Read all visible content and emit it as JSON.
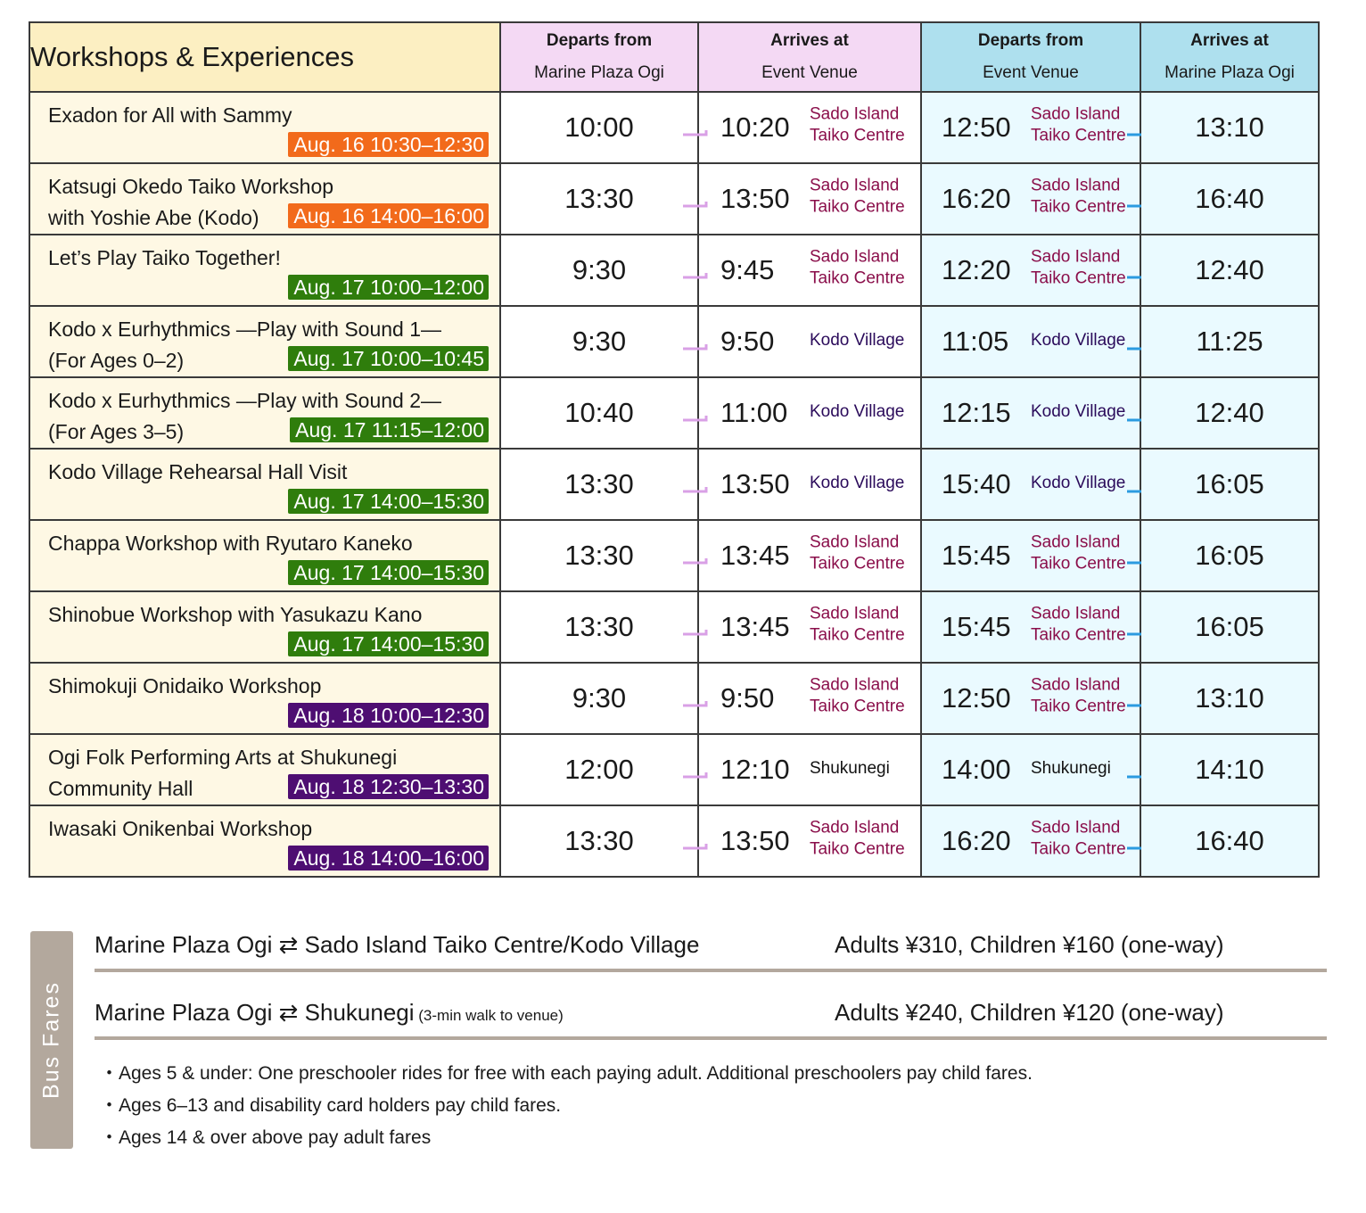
{
  "header": {
    "title": "Workshops & Experiences",
    "columns": [
      {
        "line1": "Departs from",
        "line2": "Marine Plaza Ogi"
      },
      {
        "line1": "Arrives at",
        "line2": "Event Venue"
      },
      {
        "line1": "Departs from",
        "line2": "Event Venue"
      },
      {
        "line1": "Arrives at",
        "line2": "Marine Plaza Ogi"
      }
    ]
  },
  "colors": {
    "aug16": "#f26a1b",
    "aug17": "#2f7d0c",
    "aug18": "#4e0e72",
    "outbound_arrow": "#d9a0e6",
    "return_arrow": "#2b9be0",
    "header_title_bg": "#fcefc2",
    "header_outbound_bg": "#f4d9f4",
    "header_return_bg": "#aee0ee",
    "fare_bar": "#b3a89d"
  },
  "rows": [
    {
      "name": "Exadon for All with Sammy",
      "badge": "Aug. 16  10:30–12:30",
      "day": "aug16",
      "dep": "10:00",
      "arr": "10:20",
      "venue1": "Sado Island",
      "venue2": "Taiko Centre",
      "vtype": "taiko",
      "ret_dep": "12:50",
      "ret_arr": "13:10"
    },
    {
      "name": "Katsugi Okedo Taiko Workshop\nwith Yoshie Abe (Kodo)",
      "badge": "Aug. 16  14:00–16:00",
      "day": "aug16",
      "dep": "13:30",
      "arr": "13:50",
      "venue1": "Sado Island",
      "venue2": "Taiko Centre",
      "vtype": "taiko",
      "ret_dep": "16:20",
      "ret_arr": "16:40"
    },
    {
      "name": "Let’s Play Taiko Together!",
      "badge": "Aug. 17  10:00–12:00",
      "day": "aug17",
      "dep": "9:30",
      "arr": "9:45",
      "venue1": "Sado Island",
      "venue2": "Taiko Centre",
      "vtype": "taiko",
      "ret_dep": "12:20",
      "ret_arr": "12:40"
    },
    {
      "name": "Kodo x Eurhythmics —Play with Sound 1—\n(For Ages 0–2)",
      "badge": "Aug. 17  10:00–10:45",
      "day": "aug17",
      "dep": "9:30",
      "arr": "9:50",
      "venue1": "Kodo Village",
      "venue2": "",
      "vtype": "kodo",
      "ret_dep": "11:05",
      "ret_arr": "11:25"
    },
    {
      "name": "Kodo x Eurhythmics —Play with Sound 2—\n(For Ages 3–5)",
      "badge": "Aug. 17  11:15–12:00",
      "day": "aug17",
      "dep": "10:40",
      "arr": "11:00",
      "venue1": "Kodo Village",
      "venue2": "",
      "vtype": "kodo",
      "ret_dep": "12:15",
      "ret_arr": "12:40"
    },
    {
      "name": "Kodo Village Rehearsal Hall Visit",
      "badge": "Aug. 17  14:00–15:30",
      "day": "aug17",
      "dep": "13:30",
      "arr": "13:50",
      "venue1": "Kodo Village",
      "venue2": "",
      "vtype": "kodo",
      "ret_dep": "15:40",
      "ret_arr": "16:05"
    },
    {
      "name": "Chappa Workshop with Ryutaro Kaneko",
      "badge": "Aug. 17  14:00–15:30",
      "day": "aug17",
      "dep": "13:30",
      "arr": "13:45",
      "venue1": "Sado Island",
      "venue2": "Taiko Centre",
      "vtype": "taiko",
      "ret_dep": "15:45",
      "ret_arr": "16:05"
    },
    {
      "name": "Shinobue Workshop with Yasukazu Kano",
      "badge": "Aug. 17  14:00–15:30",
      "day": "aug17",
      "dep": "13:30",
      "arr": "13:45",
      "venue1": "Sado Island",
      "venue2": "Taiko Centre",
      "vtype": "taiko",
      "ret_dep": "15:45",
      "ret_arr": "16:05"
    },
    {
      "name": "Shimokuji Onidaiko Workshop",
      "badge": "Aug. 18  10:00–12:30",
      "day": "aug18",
      "dep": "9:30",
      "arr": "9:50",
      "venue1": "Sado Island",
      "venue2": "Taiko Centre",
      "vtype": "taiko",
      "ret_dep": "12:50",
      "ret_arr": "13:10"
    },
    {
      "name": "Ogi Folk Performing Arts at Shukunegi\nCommunity Hall",
      "badge": "Aug. 18  12:30–13:30",
      "day": "aug18",
      "dep": "12:00",
      "arr": "12:10",
      "venue1": "Shukunegi",
      "venue2": "",
      "vtype": "shuku",
      "ret_dep": "14:00",
      "ret_arr": "14:10"
    },
    {
      "name": "Iwasaki Onikenbai Workshop",
      "badge": "Aug. 18  14:00–16:00",
      "day": "aug18",
      "dep": "13:30",
      "arr": "13:50",
      "venue1": "Sado Island",
      "venue2": "Taiko Centre",
      "vtype": "taiko",
      "ret_dep": "16:20",
      "ret_arr": "16:40"
    }
  ],
  "fares": {
    "label": "Bus Fares",
    "routes": [
      {
        "route": "Marine Plaza Ogi  ⇄  Sado Island Taiko Centre/Kodo Village",
        "note": "",
        "price": "Adults ¥310, Children ¥160 (one-way)"
      },
      {
        "route": "Marine Plaza Ogi  ⇄  Shukunegi",
        "note": " (3-min walk to venue)",
        "price": "Adults ¥240, Children ¥120 (one-way)"
      }
    ],
    "notes": [
      "・Ages 5 & under: One preschooler rides for free with each paying adult.  Additional preschoolers pay child fares.",
      "・Ages 6–13 and disability card holders pay child fares.",
      "・Ages 14 & over above pay adult fares"
    ]
  }
}
